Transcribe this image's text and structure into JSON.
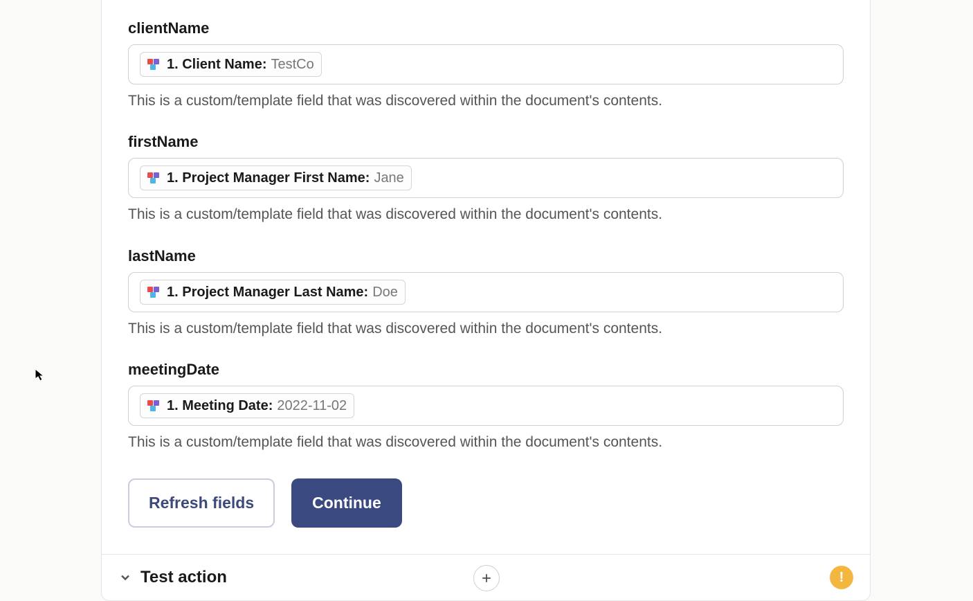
{
  "description": "This is a custom/template field that was discovered within the document's contents.",
  "fields": [
    {
      "label": "clientName",
      "pillLabel": "1. Client Name:",
      "pillValue": "TestCo"
    },
    {
      "label": "firstName",
      "pillLabel": "1. Project Manager First Name:",
      "pillValue": "Jane"
    },
    {
      "label": "lastName",
      "pillLabel": "1. Project Manager Last Name:",
      "pillValue": "Doe"
    },
    {
      "label": "meetingDate",
      "pillLabel": "1. Meeting Date:",
      "pillValue": "2022-11-02"
    }
  ],
  "buttons": {
    "refresh": "Refresh fields",
    "continue": "Continue"
  },
  "testAction": {
    "label": "Test action",
    "warning": "!"
  }
}
